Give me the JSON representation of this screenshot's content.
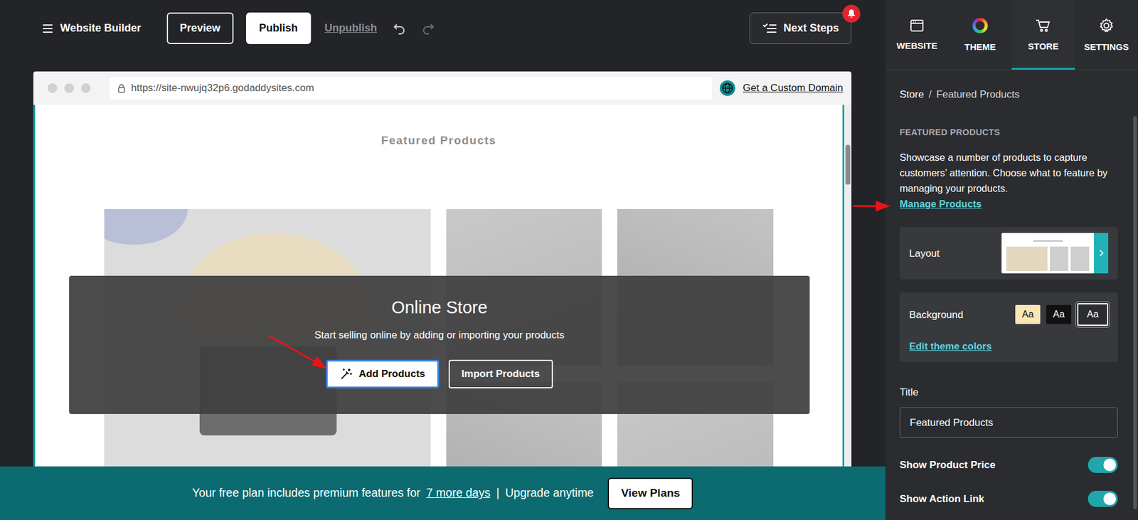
{
  "toolbar": {
    "title": "Website Builder",
    "buttons": [
      {
        "label": "Preview",
        "kind": "outline"
      },
      {
        "label": "Publish",
        "kind": "solid"
      },
      {
        "label": "Unpublish",
        "kind": "link"
      }
    ],
    "history": [
      {
        "kind": "undo",
        "disabled": false
      },
      {
        "kind": "redo",
        "disabled": true
      }
    ],
    "next_steps": "Next Steps"
  },
  "browser": {
    "url": "https://site-nwujq32p6.godaddysites.com",
    "domain_link": "Get a Custom Domain"
  },
  "section": {
    "title": "Featured Products"
  },
  "overlay": {
    "title": "Online Store",
    "text": "Start selling online by adding or importing your products",
    "buttons": [
      {
        "label": "Add Products",
        "kind": "primary"
      },
      {
        "label": "Import Products",
        "kind": "outline"
      }
    ]
  },
  "banner": {
    "text_before": "Your free plan includes premium features for",
    "link": "7 more days",
    "separator": "|",
    "text_after": "Upgrade anytime",
    "button": "View Plans"
  },
  "panel": {
    "tabs": [
      {
        "label": "WEBSITE",
        "selected": false,
        "kind": "website"
      },
      {
        "label": "THEME",
        "selected": false,
        "kind": "theme"
      },
      {
        "label": "STORE",
        "selected": true,
        "kind": "store"
      },
      {
        "label": "SETTINGS",
        "selected": false,
        "kind": "settings"
      }
    ],
    "breadcrumb": [
      "Store",
      "Featured Products"
    ],
    "breadcrumb_separator": "/",
    "heading": "FEATURED PRODUCTS",
    "description": "Showcase a number of products to capture customers’ attention. Choose what to feature by managing your products.",
    "link": "Manage Products",
    "layout_label": "Layout",
    "background": {
      "label": "Background",
      "link": "Edit theme colors",
      "swatches": [
        {
          "label": "Aa",
          "selected": false,
          "color": "#fbe6b6"
        },
        {
          "label": "Aa",
          "selected": false,
          "color": "#111111"
        },
        {
          "label": "Aa",
          "selected": true,
          "color": "#2b2c30"
        }
      ]
    },
    "title_field": {
      "label": "Title",
      "value": "Featured Products"
    },
    "toggles": [
      {
        "label": "Show Product Price",
        "on": true
      },
      {
        "label": "Show Action Link",
        "on": true
      }
    ]
  }
}
